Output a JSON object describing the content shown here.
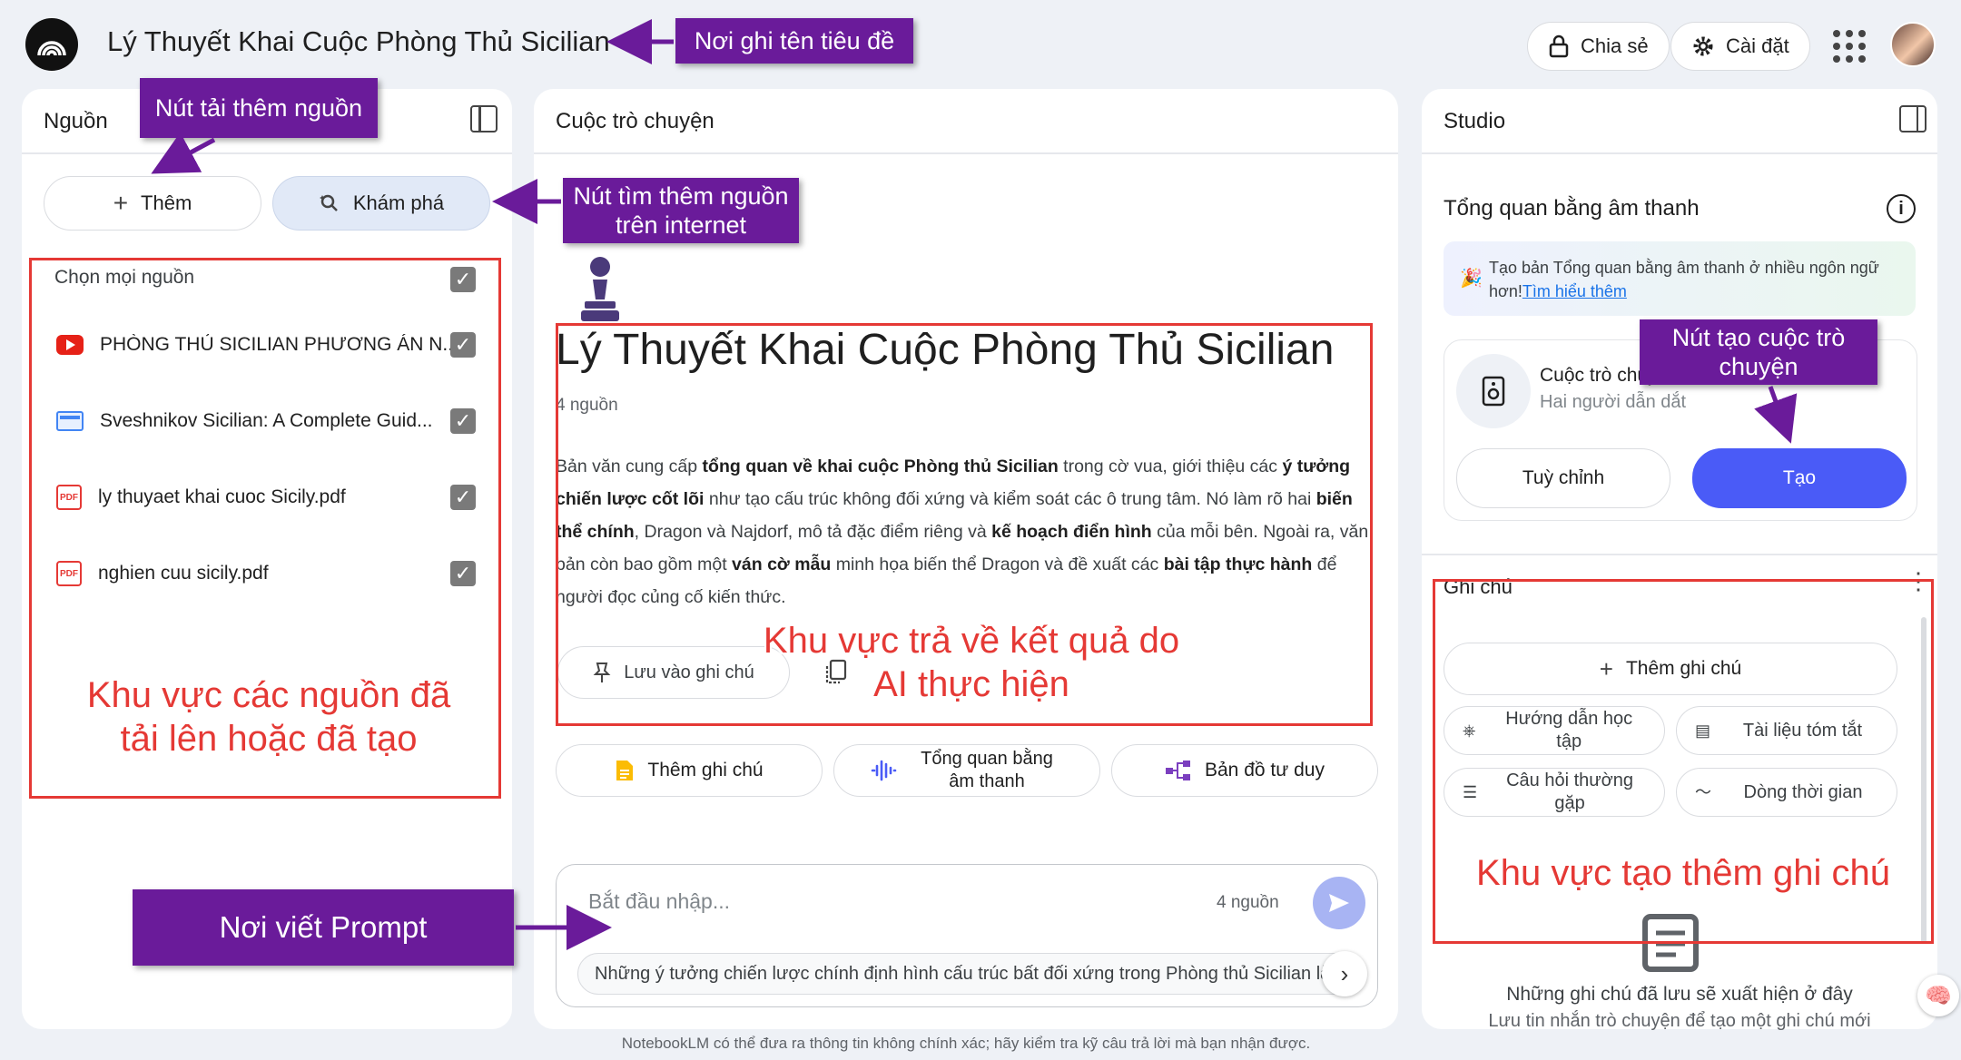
{
  "header": {
    "title": "Lý Thuyết Khai Cuộc Phòng Thủ Sicilian",
    "share_label": "Chia sẻ",
    "settings_label": "Cài đặt"
  },
  "sources": {
    "title": "Nguồn",
    "add_label": "Thêm",
    "discover_label": "Khám phá",
    "select_all_label": "Chọn mọi nguồn",
    "items": [
      {
        "label": "PHÒNG THỦ SICILIAN PHƯƠNG ÁN N...",
        "icon": "youtube-icon"
      },
      {
        "label": "Sveshnikov Sicilian: A Complete Guid...",
        "icon": "web-icon"
      },
      {
        "label": "ly thuyaet khai cuoc Sicily.pdf",
        "icon": "pdf-icon"
      },
      {
        "label": "nghien cuu sicily.pdf",
        "icon": "pdf-icon"
      }
    ]
  },
  "chat": {
    "title": "Cuộc trò chuyện",
    "notebook_title": "Lý Thuyết Khai Cuộc Phòng Thủ Sicilian",
    "source_count": "4 nguồn",
    "summary": {
      "p1": "Bản văn cung cấp ",
      "b1": "tổng quan về khai cuộc Phòng thủ Sicilian",
      "p2": " trong cờ vua, giới thiệu các ",
      "b2": "ý tưởng chiến lược cốt lõi",
      "p3": " như tạo cấu trúc không đối xứng và kiểm soát các ô trung tâm. Nó làm rõ hai ",
      "b3": "biến thể chính",
      "p4": ", Dragon và Najdorf, mô tả đặc điểm riêng và ",
      "b4": "kế hoạch điển hình",
      "p5": " của mỗi bên. Ngoài ra, văn bản còn bao gồm một ",
      "b5": "ván cờ mẫu",
      "p6": " minh họa biến thể Dragon và đề xuất các ",
      "b6": "bài tập thực hành",
      "p7": " để người đọc củng cố kiến thức."
    },
    "save_note_label": "Lưu vào ghi chú",
    "actions": [
      "Thêm ghi chú",
      "Tổng quan bằng âm thanh",
      "Bản đồ tư duy"
    ],
    "input_placeholder": "Bắt đầu nhập...",
    "input_source_count": "4 nguồn",
    "suggestion": "Những ý tưởng chiến lược chính định hình cấu trúc bất đối xứng trong Phòng thủ Sicilian là gì?",
    "disclaimer": "NotebookLM có thể đưa ra thông tin không chính xác; hãy kiểm tra kỹ câu trả lời mà bạn nhận được."
  },
  "studio": {
    "title": "Studio",
    "audio_overview_title": "Tổng quan bằng âm thanh",
    "banner_text": "Tạo bản Tổng quan bằng âm thanh ở nhiều ngôn ngữ hơn!",
    "banner_link": "Tìm hiểu thêm",
    "conversation_title": "Cuộc trò chuyện",
    "conversation_subtitle": "Hai người dẫn dắt",
    "customize_label": "Tuỳ chỉnh",
    "create_label": "Tạo",
    "notes_title": "Ghi chú",
    "add_note_label": "Thêm ghi chú",
    "note_buttons": [
      "Hướng dẫn học tập",
      "Tài liệu tóm tắt",
      "Câu hỏi thường gặp",
      "Dòng thời gian"
    ],
    "empty_title": "Những ghi chú đã lưu sẽ xuất hiện ở đây",
    "empty_sub": "Lưu tin nhắn trò chuyện để tạo một ghi chú mới"
  },
  "annotations": {
    "title_label": "Nơi ghi tên tiêu đề",
    "add_source_label": "Nút tải thêm nguồn",
    "discover_label": "Nút tìm thêm nguồn trên internet",
    "sources_area": "Khu vực các nguồn đã tải lên hoặc đã tạo",
    "ai_area": "Khu vực trả về kết quả do AI thực hiện",
    "prompt_label": "Nơi viết Prompt",
    "create_conv_label": "Nút tạo cuộc trò chuyện",
    "notes_area": "Khu vực tạo thêm ghi chú"
  },
  "colors": {
    "accent": "#4a5bf7",
    "annotation_purple": "#6a1b9a",
    "annotation_red": "#e53935"
  }
}
